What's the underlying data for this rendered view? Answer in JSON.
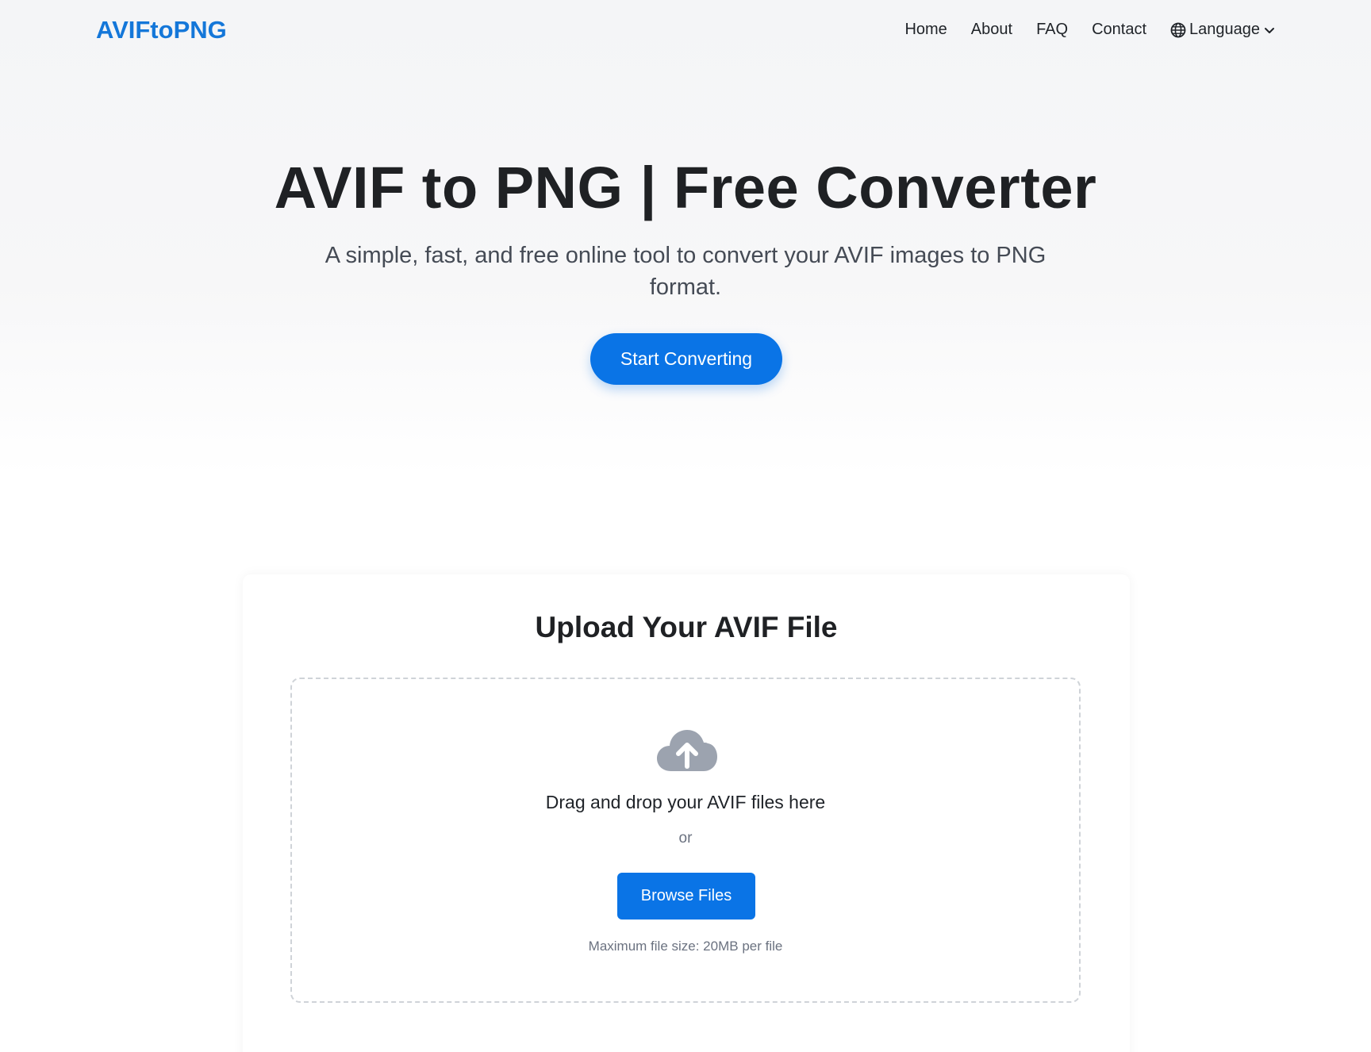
{
  "header": {
    "logo": "AVIFtoPNG",
    "nav": [
      {
        "label": "Home"
      },
      {
        "label": "About"
      },
      {
        "label": "FAQ"
      },
      {
        "label": "Contact"
      }
    ],
    "language_label": "Language",
    "language_icon": "globe-icon",
    "language_chevron_icon": "chevron-down-icon"
  },
  "hero": {
    "title": "AVIF to PNG | Free Converter",
    "subtitle": "A simple, fast, and free online tool to convert your AVIF images to PNG format.",
    "cta_label": "Start Converting"
  },
  "upload": {
    "title": "Upload Your AVIF File",
    "icon": "cloud-upload-icon",
    "drop_text": "Drag and drop your AVIF files here",
    "or_text": "or",
    "browse_label": "Browse Files",
    "max_size_text": "Maximum file size: 20MB per file"
  },
  "colors": {
    "accent": "#0a74e6",
    "logo": "#1477d9",
    "icon_gray": "#9ca3af"
  }
}
